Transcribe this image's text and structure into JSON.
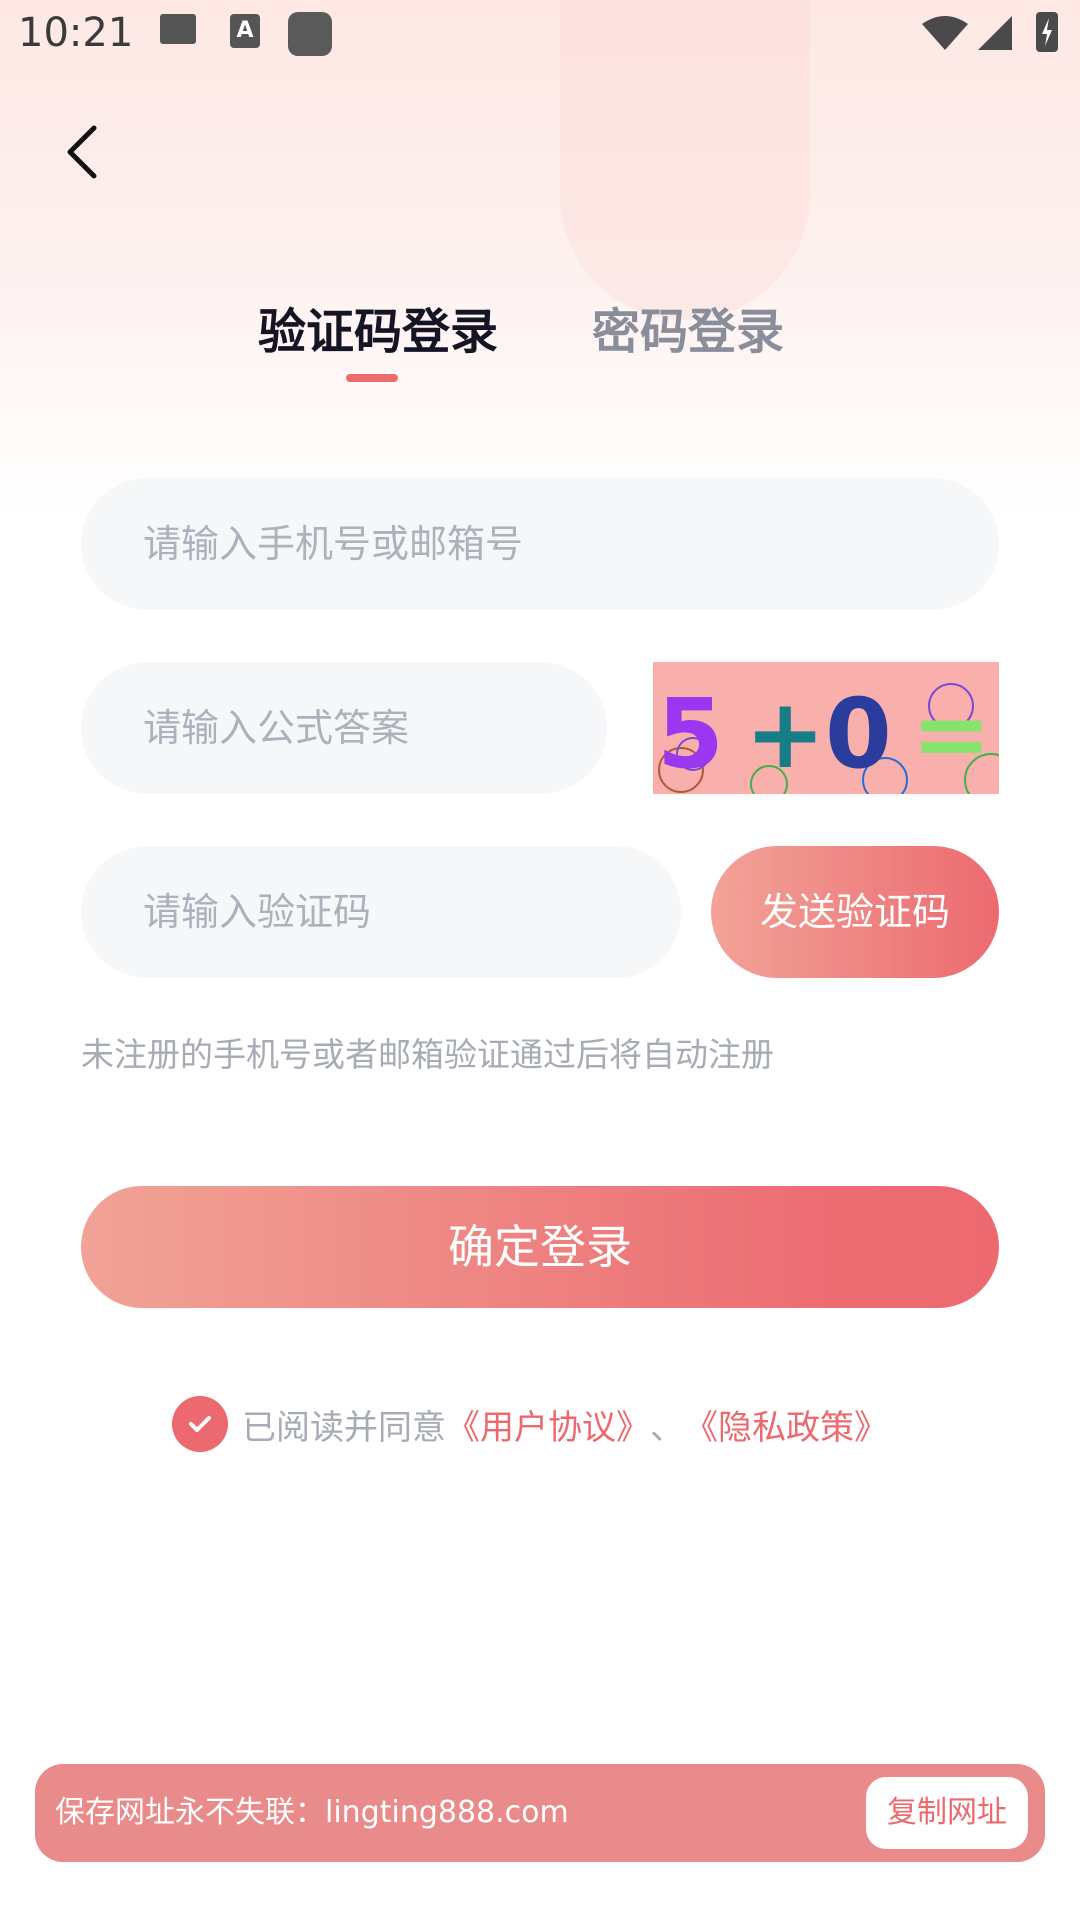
{
  "status_bar": {
    "time": "10:21",
    "icons": [
      "image-icon",
      "font-icon",
      "app-square-icon",
      "wifi-icon",
      "signal-icon",
      "battery-charging-icon"
    ]
  },
  "header": {
    "back_icon": "chevron-left-icon"
  },
  "tabs": [
    {
      "label": "验证码登录",
      "active": true
    },
    {
      "label": "密码登录",
      "active": false
    }
  ],
  "form": {
    "account_placeholder": "请输入手机号或邮箱号",
    "account_value": "",
    "captcha_placeholder": "请输入公式答案",
    "captcha_value": "",
    "captcha_image_chars": [
      "5",
      "+",
      "0",
      "="
    ],
    "code_placeholder": "请输入验证码",
    "code_value": "",
    "send_code_label": "发送验证码",
    "hint": "未注册的手机号或者邮箱验证通过后将自动注册",
    "login_label": "确定登录"
  },
  "agreement": {
    "checked": true,
    "prefix": "已阅读并同意",
    "user_agreement": "《用户协议》",
    "separator": "、",
    "privacy_policy": "《隐私政策》"
  },
  "banner": {
    "text": "保存网址永不失联：lingting888.com",
    "copy_label": "复制网址"
  },
  "colors": {
    "accent": "#ec6a6f",
    "accent_light": "#f2a398",
    "banner": "#e88b8a",
    "input_bg": "#f6f7f9",
    "placeholder": "#adb1bb"
  }
}
